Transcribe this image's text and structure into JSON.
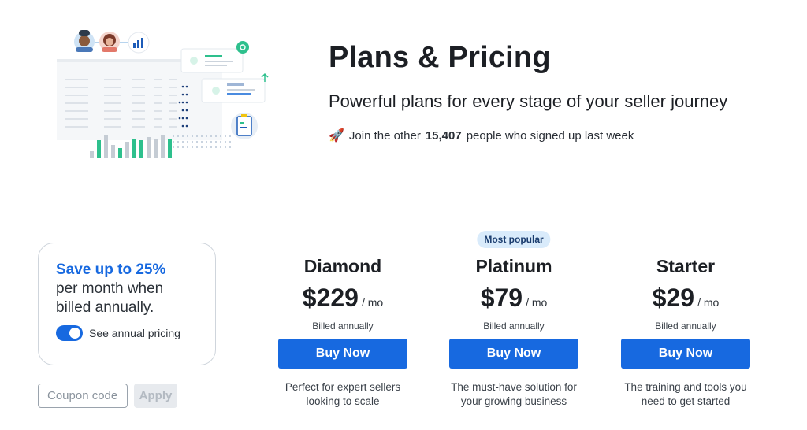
{
  "hero": {
    "title": "Plans & Pricing",
    "subtitle": "Powerful plans for every stage of your seller journey",
    "join_prefix": "Join the other",
    "join_count": "15,407",
    "join_suffix": "people who signed up last week",
    "rocket_icon": "🚀"
  },
  "savings": {
    "highlight": "Save up to 25%",
    "line2": "per month when",
    "line3": "billed annually.",
    "toggle_label": "See annual pricing",
    "toggle_on": true
  },
  "coupon": {
    "placeholder": "Coupon code",
    "apply_label": "Apply"
  },
  "plans": [
    {
      "name": "Diamond",
      "price": "$229",
      "per": "/ mo",
      "billed": "Billed annually",
      "cta": "Buy Now",
      "desc_line1": "Perfect for expert sellers",
      "desc_line2": "looking to scale"
    },
    {
      "badge": "Most popular",
      "name": "Platinum",
      "price": "$79",
      "per": "/ mo",
      "billed": "Billed annually",
      "cta": "Buy Now",
      "desc_line1": "The must-have solution for",
      "desc_line2": "your growing business"
    },
    {
      "name": "Starter",
      "price": "$29",
      "per": "/ mo",
      "billed": "Billed annually",
      "cta": "Buy Now",
      "desc_line1": "The training and tools you",
      "desc_line2": "need to get started"
    }
  ],
  "colors": {
    "accent": "#1769e0",
    "badge_bg": "#d9ebfb",
    "illustration_green": "#2ec08d"
  }
}
